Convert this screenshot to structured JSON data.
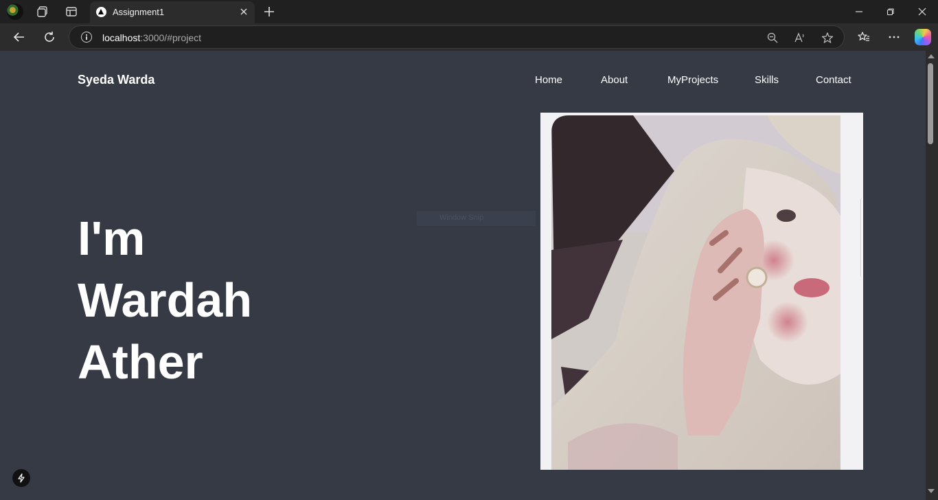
{
  "browser": {
    "tab_title": "Assignment1",
    "url_host": "localhost",
    "url_rest": ":3000/#project"
  },
  "site": {
    "brand": "Syeda Warda",
    "nav": [
      "Home",
      "About",
      "MyProjects",
      "Skills",
      "Contact"
    ]
  },
  "hero": {
    "lines": [
      "I'm",
      "Wardah",
      "Ather"
    ]
  },
  "ghost_label": "Window Snip",
  "colors": {
    "page_bg": "#363a45",
    "chrome_bg": "#202020",
    "text": "#ffffff"
  },
  "icons": [
    "profile-avatar",
    "workspaces-icon",
    "vertical-tabs-icon",
    "close-icon",
    "plus-icon",
    "minimize-icon",
    "restore-icon",
    "back-arrow-icon",
    "reload-icon",
    "info-icon",
    "zoom-out-icon",
    "read-aloud-icon",
    "star-icon",
    "favorites-icon",
    "more-icon",
    "copilot-icon",
    "lightning-icon"
  ]
}
